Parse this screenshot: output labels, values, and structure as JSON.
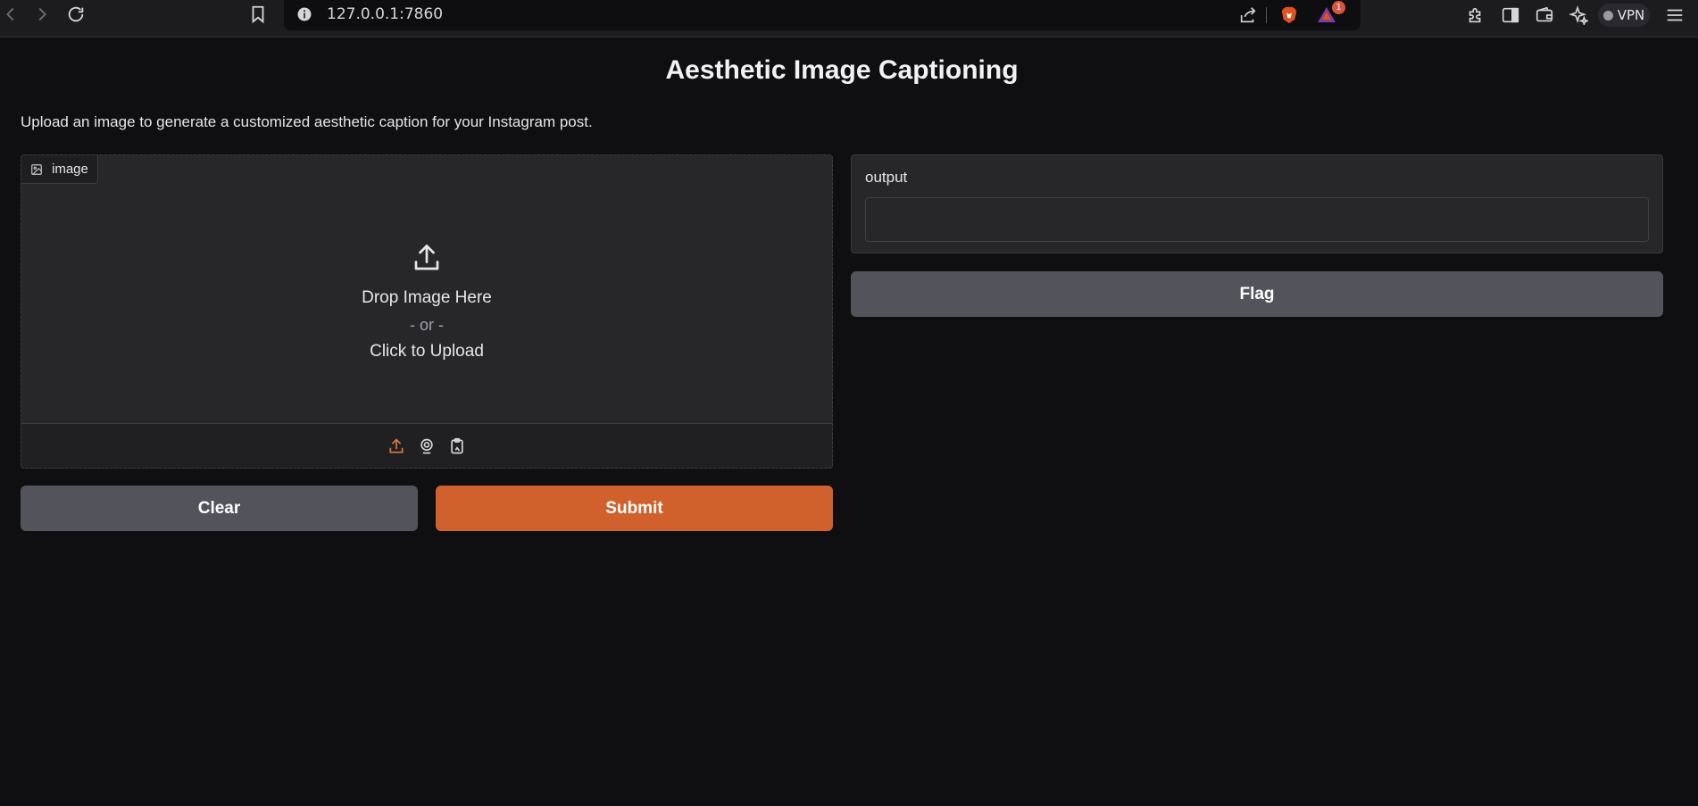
{
  "browser": {
    "url": "127.0.0.1:7860",
    "notification_count": "1",
    "vpn_label": "VPN"
  },
  "page": {
    "title": "Aesthetic Image Captioning",
    "description": "Upload an image to generate a customized aesthetic caption for your Instagram post."
  },
  "input_panel": {
    "label": "image",
    "drop_text": "Drop Image Here",
    "or_text": "- or -",
    "click_text": "Click to Upload",
    "sources": [
      "upload-icon",
      "webcam-icon",
      "clipboard-icon"
    ]
  },
  "output_panel": {
    "label": "output",
    "value": ""
  },
  "buttons": {
    "clear": "Clear",
    "submit": "Submit",
    "flag": "Flag"
  },
  "colors": {
    "background": "#0f0f11",
    "panel": "#27272a",
    "primary": "#d1612c",
    "secondary": "#53535c"
  }
}
